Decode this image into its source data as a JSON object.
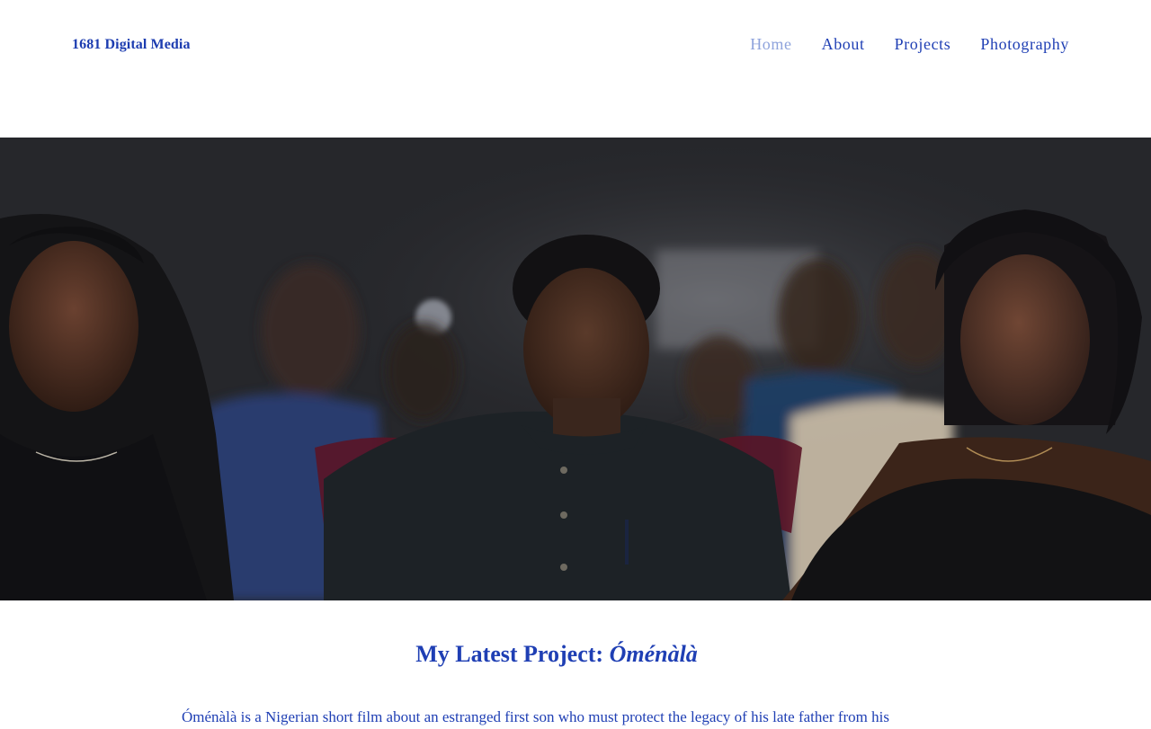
{
  "header": {
    "logo": "1681 Digital Media",
    "nav": [
      {
        "label": "Home",
        "active": true
      },
      {
        "label": "About",
        "active": false
      },
      {
        "label": "Projects",
        "active": false
      },
      {
        "label": "Photography",
        "active": false
      }
    ]
  },
  "hero": {
    "image_subject": "three viewers seated in a darkened cinema audience"
  },
  "project": {
    "title_prefix": "My Latest Project: ",
    "title_name": "Óménàlà",
    "description": "Óménàlà is a Nigerian short film about an estranged first son who must protect the legacy of his late father from his"
  },
  "colors": {
    "link": "#1f3fb4",
    "active_link": "#8ea3dc",
    "background": "#ffffff"
  }
}
